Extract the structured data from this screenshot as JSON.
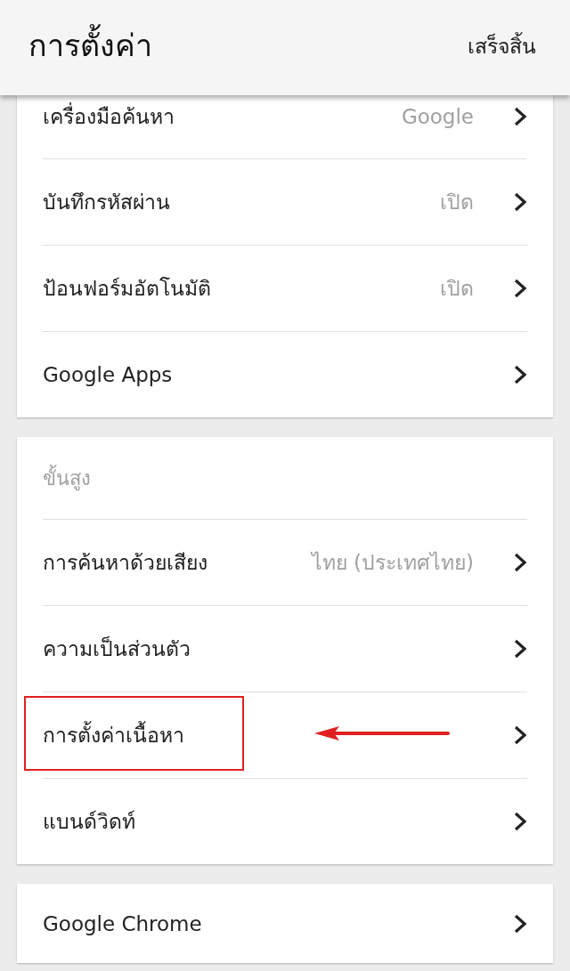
{
  "header": {
    "title": "การตั้งค่า",
    "done_button": "เสร็จสิ้น"
  },
  "sections": [
    {
      "items": [
        {
          "label": "เครื่องมือค้นหา",
          "value": "Google",
          "annotated": false
        },
        {
          "label": "บันทึกรหัสผ่าน",
          "value": "เปิด",
          "annotated": false
        },
        {
          "label": "ป้อนฟอร์มอัตโนมัติ",
          "value": "เปิด",
          "annotated": false
        },
        {
          "label": "Google Apps",
          "annotated": false
        }
      ]
    },
    {
      "heading": "ขั้นสูง",
      "items": [
        {
          "label": "การค้นหาด้วยเสียง",
          "value": "ไทย (ประเทศไทย)",
          "annotated": false
        },
        {
          "label": "ความเป็นส่วนตัว",
          "annotated": false
        },
        {
          "label": "การตั้งค่าเนื้อหา",
          "annotated": true
        },
        {
          "label": "แบนด์วิดท์",
          "annotated": false
        }
      ]
    },
    {
      "items": [
        {
          "label": "Google Chrome",
          "annotated": false
        }
      ]
    }
  ]
}
